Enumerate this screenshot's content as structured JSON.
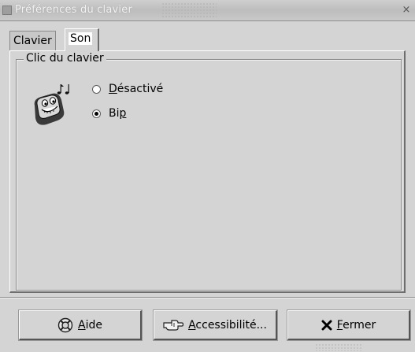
{
  "window": {
    "title": "Préférences du clavier",
    "close_glyph": "×"
  },
  "tabs": [
    {
      "label": "Clavier",
      "active": false
    },
    {
      "label": "Son",
      "active": true
    }
  ],
  "click_section": {
    "frame_title": "Clic du clavier",
    "options": [
      {
        "first": "D",
        "rest": "ésactivé",
        "selected": false
      },
      {
        "first": "Bi",
        "mnemonic": "p",
        "selected": true
      }
    ]
  },
  "buttons": {
    "help": {
      "mnemonic": "A",
      "rest": "ide",
      "icon": "help-lifebuoy-icon"
    },
    "accessibility": {
      "mnemonic": "A",
      "rest": "ccessibilité...",
      "icon": "accessibility-hand-icon"
    },
    "close": {
      "mnemonic": "F",
      "rest": "ermer",
      "icon": "close-x-icon"
    }
  }
}
